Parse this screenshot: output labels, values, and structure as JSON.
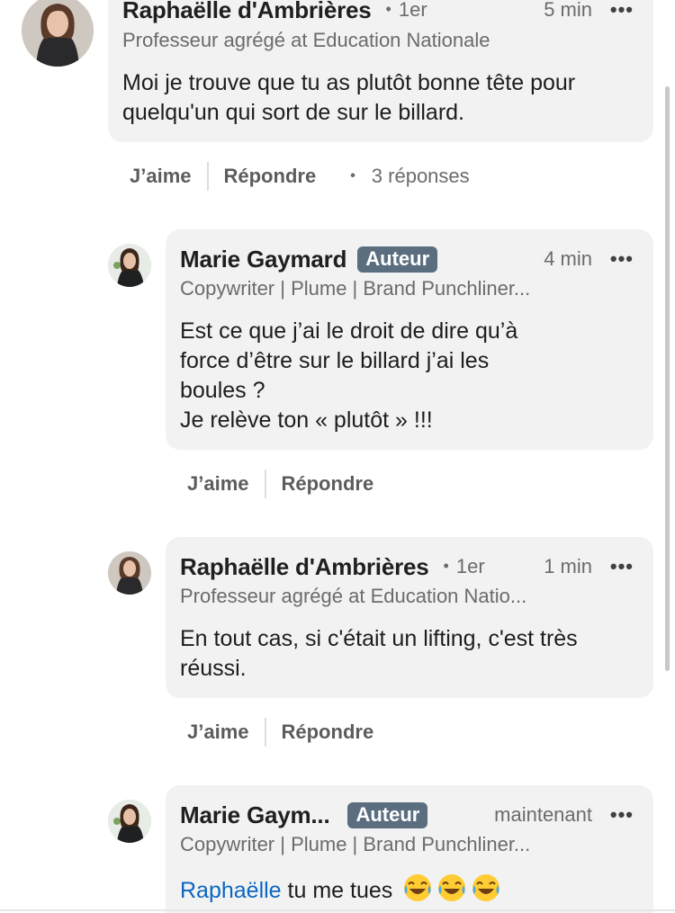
{
  "comments": [
    {
      "name": "Raphaëlle d'Ambrières",
      "degree": "1er",
      "time": "5 min",
      "headline": "Professeur agrégé at Education Nationale",
      "text": "Moi je trouve que tu as plutôt bonne tête pour quelqu'un qui sort de sur le billard.",
      "like_label": "J’aime",
      "reply_label": "Répondre",
      "replies_count": "3 réponses"
    },
    {
      "name": "Marie Gaymard",
      "badge": "Auteur",
      "time": "4 min",
      "headline": "Copywriter | Plume | Brand Punchliner...",
      "text_lines": [
        "Est ce que j’ai le droit de dire qu’à",
        "force d’être sur le billard j’ai les",
        "boules ?",
        "Je relève ton « plutôt » !!!"
      ],
      "like_label": "J’aime",
      "reply_label": "Répondre"
    },
    {
      "name": "Raphaëlle d'Ambrières",
      "degree": "1er",
      "time": "1 min",
      "headline": "Professeur agrégé at Education Natio...",
      "text": "En tout cas, si c'était un lifting, c'est très réussi.",
      "like_label": "J’aime",
      "reply_label": "Répondre"
    },
    {
      "name": "Marie Gaym...",
      "badge": "Auteur",
      "time": "maintenant",
      "headline": "Copywriter | Plume | Brand Punchliner...",
      "mention": "Raphaëlle",
      "text": " tu me tues ",
      "emoji": [
        "face-with-tears-of-joy",
        "face-with-tears-of-joy",
        "face-with-tears-of-joy"
      ]
    }
  ],
  "more_icon": "more-horizontal-icon",
  "colors": {
    "bubble": "#f2f2f2",
    "badge": "#5a6e80",
    "mention": "#0a66c2",
    "muted": "#6b6b6b"
  }
}
